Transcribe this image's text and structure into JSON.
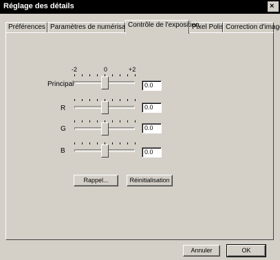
{
  "window": {
    "title": "Réglage des détails",
    "close_label": "×"
  },
  "tabs": [
    {
      "label": "Préférences",
      "active": false
    },
    {
      "label": "Paramètres de numérisation",
      "active": false
    },
    {
      "label": "Contrôle de l'exposition",
      "active": true
    },
    {
      "label": "Pixel Polish",
      "active": false
    },
    {
      "label": "Correction d'image",
      "active": false
    }
  ],
  "exposure": {
    "scale": {
      "min": "-2",
      "mid": "0",
      "max": "+2"
    },
    "sliders": [
      {
        "label": "Principal",
        "value": "0.0",
        "level": 0
      },
      {
        "label": "R",
        "value": "0.0",
        "level": 0
      },
      {
        "label": "G",
        "value": "0.0",
        "level": 0
      },
      {
        "label": "B",
        "value": "0.0",
        "level": 0
      }
    ]
  },
  "buttons": {
    "recall": "Rappel...",
    "reset": "Réinitialisation",
    "cancel": "Annuler",
    "ok": "OK"
  }
}
